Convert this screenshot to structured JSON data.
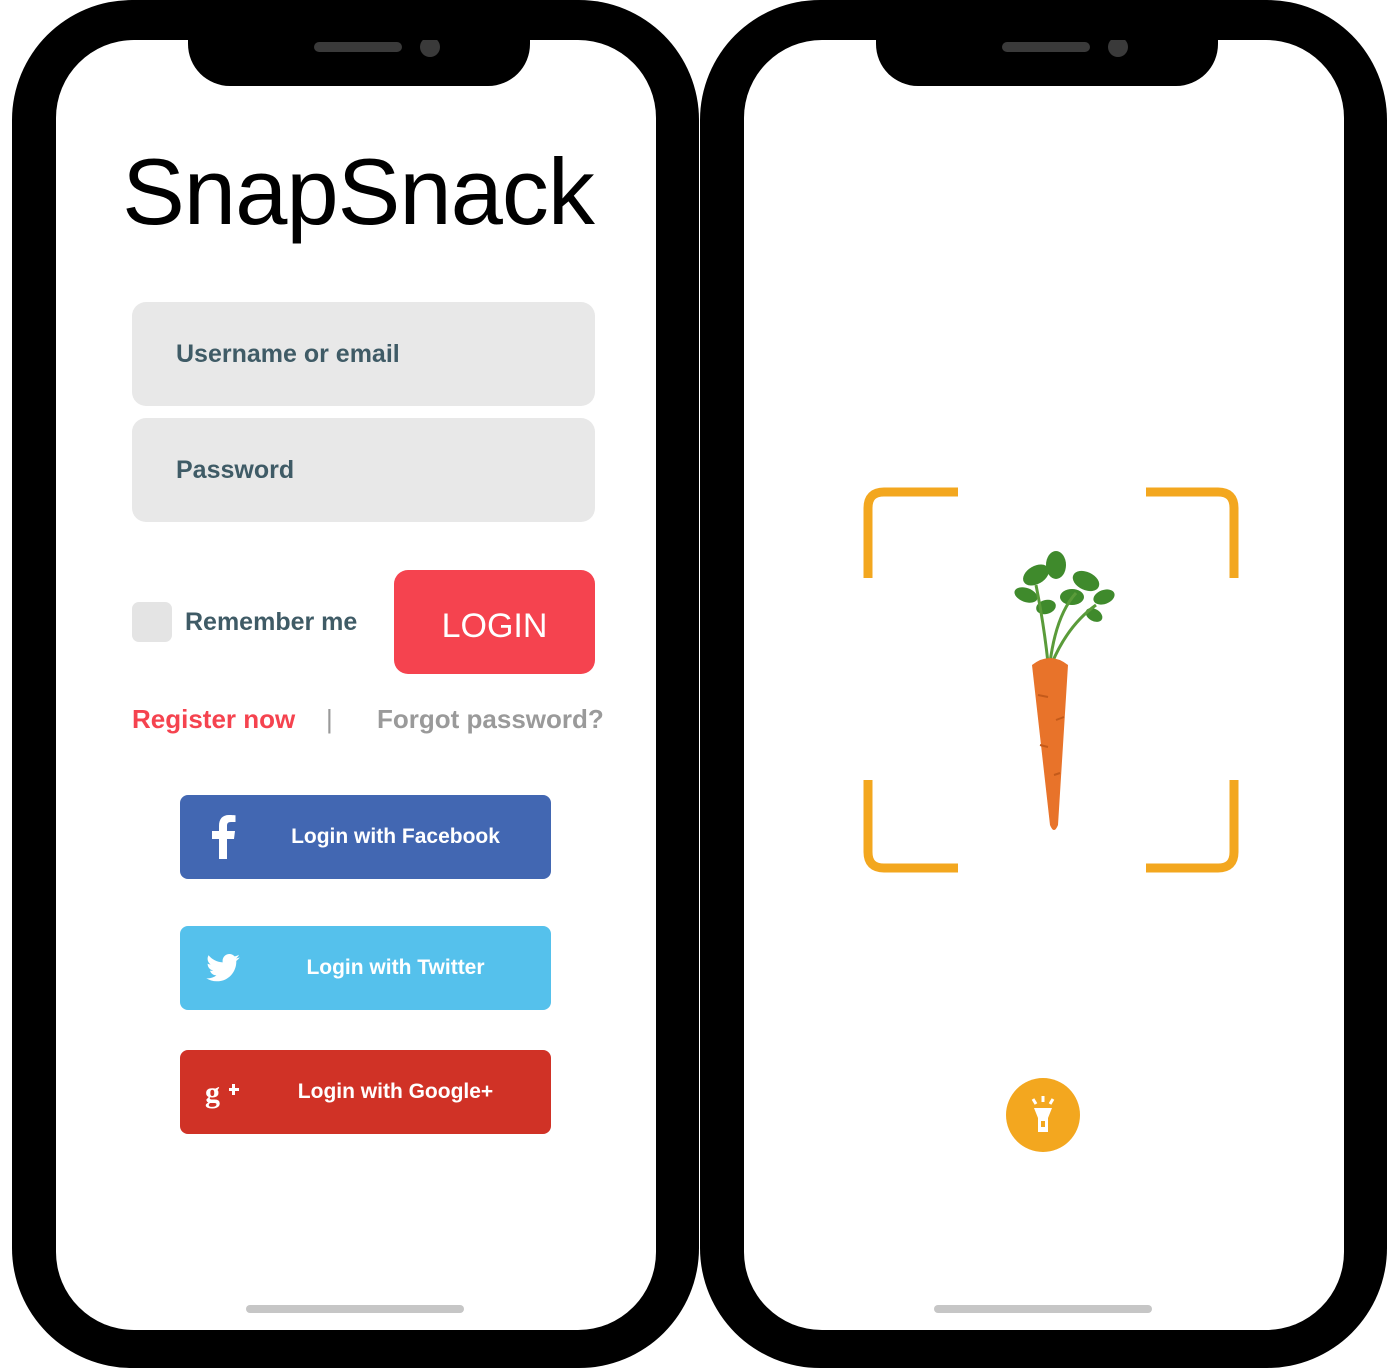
{
  "login_screen": {
    "app_title": "SnapSnack",
    "username_placeholder": "Username or email",
    "password_placeholder": "Password",
    "remember_label": "Remember me",
    "login_label": "LOGIN",
    "register_label": "Register now",
    "separator": "|",
    "forgot_label": "Forgot password?",
    "social": [
      {
        "label": "Login with Facebook",
        "icon": "facebook-icon",
        "color": "#4267b2"
      },
      {
        "label": "Login with Twitter",
        "icon": "twitter-icon",
        "color": "#55c1ec"
      },
      {
        "label": "Login with Google+",
        "icon": "google-plus-icon",
        "color": "#d03226"
      }
    ],
    "accent_color": "#f5434f"
  },
  "scanner_screen": {
    "subject": "carrot",
    "frame_color": "#f3a71f",
    "action_icon": "flashlight-icon"
  }
}
